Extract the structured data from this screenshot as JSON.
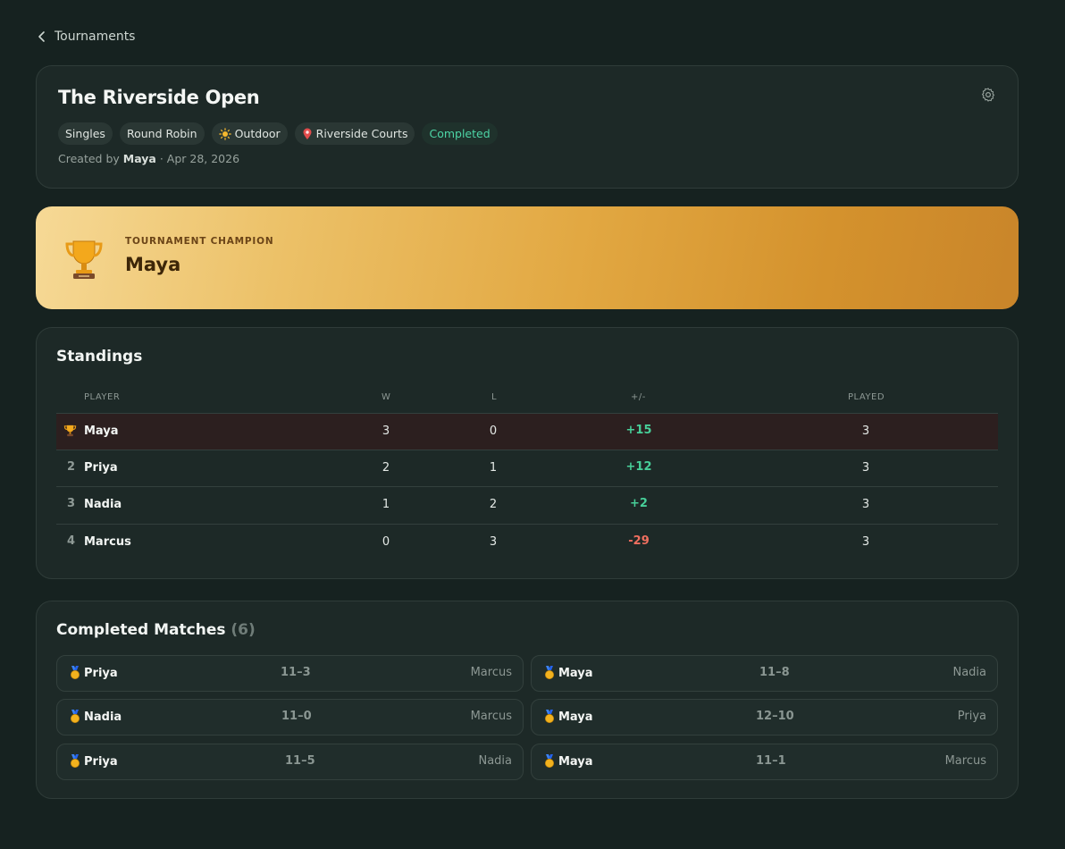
{
  "nav": {
    "back_label": "Tournaments"
  },
  "tournament": {
    "title": "The Riverside Open",
    "chips": [
      "Singles",
      "Round Robin",
      "Outdoor",
      "Riverside Courts"
    ],
    "status": "Completed",
    "created_prefix": "Created by",
    "created_by": "Maya",
    "created_date": "· Apr 28, 2026"
  },
  "champion": {
    "label": "TOURNAMENT CHAMPION",
    "name": "Maya"
  },
  "standings": {
    "title": "Standings",
    "columns": [
      "PLAYER",
      "W",
      "L",
      "+/-",
      "PLAYED"
    ],
    "rows": [
      {
        "rank": "",
        "name": "Maya",
        "w": "3",
        "l": "0",
        "diff": "+15",
        "played": "3"
      },
      {
        "rank": "2",
        "name": "Priya",
        "w": "2",
        "l": "1",
        "diff": "+12",
        "played": "3"
      },
      {
        "rank": "3",
        "name": "Nadia",
        "w": "1",
        "l": "2",
        "diff": "+2",
        "played": "3"
      },
      {
        "rank": "4",
        "name": "Marcus",
        "w": "0",
        "l": "3",
        "diff": "-29",
        "played": "3"
      }
    ]
  },
  "matches": {
    "title": "Completed Matches",
    "count": "(6)",
    "items": [
      {
        "winner": "Priya",
        "score": "11–3",
        "loser": "Marcus"
      },
      {
        "winner": "Maya",
        "score": "11–8",
        "loser": "Nadia"
      },
      {
        "winner": "Nadia",
        "score": "11–0",
        "loser": "Marcus"
      },
      {
        "winner": "Maya",
        "score": "12–10",
        "loser": "Priya"
      },
      {
        "winner": "Priya",
        "score": "11–5",
        "loser": "Nadia"
      },
      {
        "winner": "Maya",
        "score": "11–1",
        "loser": "Marcus"
      }
    ]
  },
  "colors": {
    "background": "#162220",
    "card": "#1d2927",
    "accent_green": "#47cf99",
    "accent_red": "#ef6f5f",
    "champion_gold": "#e2a842"
  }
}
